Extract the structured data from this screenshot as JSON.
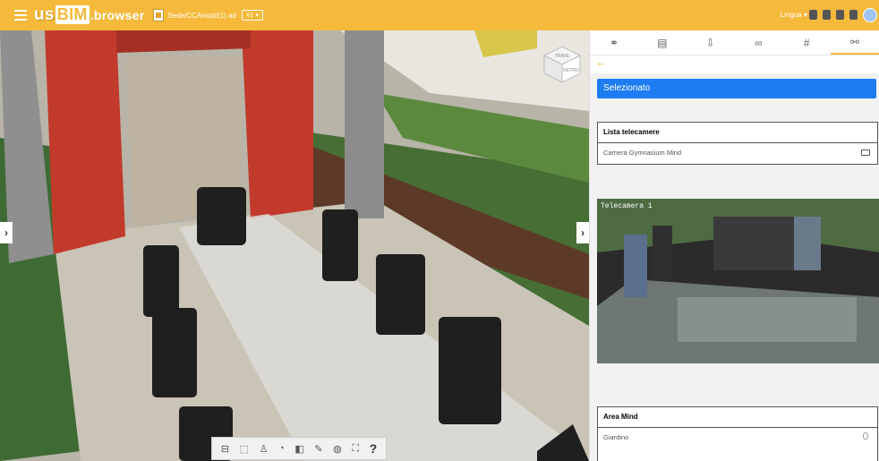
{
  "app": {
    "logo_us": "us",
    "logo_bim": "BIM",
    "logo_browser": ".browser",
    "filename": "Sede/CCAmod/(1) ad",
    "version": "V1 ▾"
  },
  "header": {
    "language": "Lingua ▾"
  },
  "panel": {
    "tabs": [
      {
        "icon": "people-icon",
        "glyph": "⚭"
      },
      {
        "icon": "document-icon",
        "glyph": "▤"
      },
      {
        "icon": "export-icon",
        "glyph": "⇩"
      },
      {
        "icon": "link-icon",
        "glyph": "∞"
      },
      {
        "icon": "hash-icon",
        "glyph": "#"
      },
      {
        "icon": "binoculars-icon",
        "glyph": "⚯"
      }
    ],
    "back": "←",
    "selected_label": "Selezionato",
    "cameras": {
      "header": "Lista telecamere",
      "items": [
        "Camera Gymnasium Mind"
      ]
    },
    "camera_feed": {
      "overlay_label": "Telecamera 1"
    },
    "area": {
      "header": "Area Mind",
      "items": [
        "Giardino"
      ]
    }
  },
  "viewer": {
    "left_arrow": "›",
    "right_arrow": "›",
    "cube_top": "TRAVE",
    "cube_right": "RETRO",
    "toolbar_help": "?"
  },
  "colors": {
    "accent": "#f5b93b",
    "selected": "#1d7cf2",
    "wall": "#c23a2b"
  }
}
